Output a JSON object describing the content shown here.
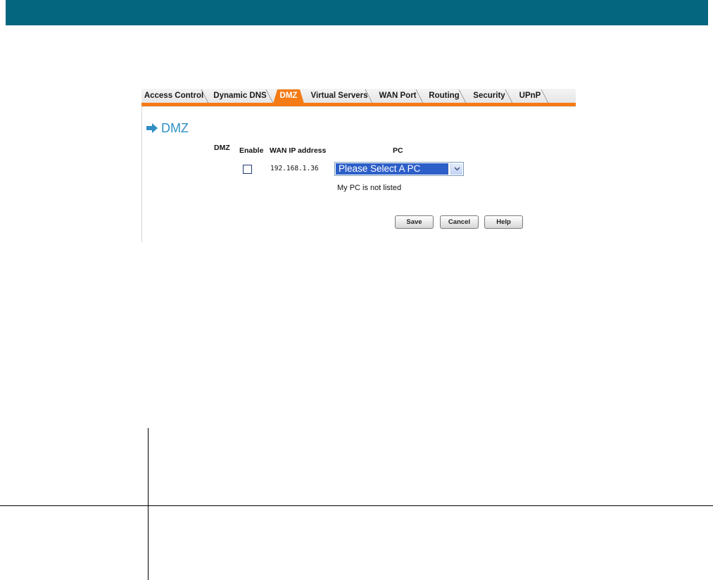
{
  "tabs": [
    {
      "label": "Access Control",
      "active": false
    },
    {
      "label": "Dynamic DNS",
      "active": false
    },
    {
      "label": "DMZ",
      "active": true
    },
    {
      "label": "Virtual Servers",
      "active": false
    },
    {
      "label": "WAN Port",
      "active": false
    },
    {
      "label": "Routing",
      "active": false
    },
    {
      "label": "Security",
      "active": false
    },
    {
      "label": "UPnP",
      "active": false
    }
  ],
  "heading": {
    "icon": "arrow-right-icon",
    "title": "DMZ"
  },
  "form": {
    "row_label": "DMZ",
    "enable_header": "Enable",
    "wan_ip_header": "WAN IP address",
    "pc_header": "PC",
    "enable_checked": false,
    "wan_ip": "192.168.1.36",
    "pc_select_value": "Please Select A PC",
    "not_listed_text": "My PC is not listed"
  },
  "buttons": {
    "save": "Save",
    "cancel": "Cancel",
    "help": "Help"
  },
  "colors": {
    "banner": "#05677f",
    "accent_orange": "#f47b16",
    "heading_blue": "#2f8fc4",
    "select_highlight": "#2d5fc9"
  }
}
